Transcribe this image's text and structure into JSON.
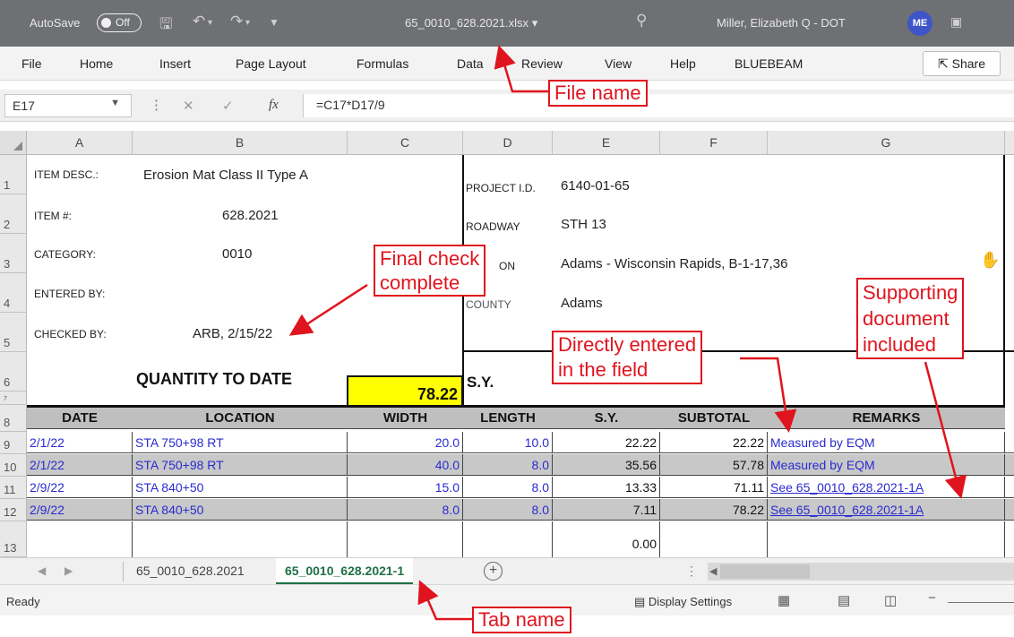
{
  "window": {
    "autosave_label": "AutoSave",
    "autosave_state": "Off",
    "filename": "65_0010_628.2021.xlsx",
    "filename_caret": "▾",
    "user_name": "Miller, Elizabeth Q - DOT",
    "user_initials": "ME"
  },
  "ribbon": {
    "tabs": [
      "File",
      "Home",
      "Insert",
      "Page Layout",
      "Formulas",
      "Data",
      "Review",
      "View",
      "Help",
      "BLUEBEAM"
    ],
    "share_label": "Share"
  },
  "formula_bar": {
    "cell_ref": "E17",
    "fx": "fx",
    "formula": "=C17*D17/9"
  },
  "columns": [
    "A",
    "B",
    "C",
    "D",
    "E",
    "F",
    "G"
  ],
  "rows": [
    "1",
    "2",
    "3",
    "4",
    "5",
    "6",
    "7",
    "8",
    "9",
    "10",
    "11",
    "12",
    "13"
  ],
  "header_block": {
    "item_desc_label": "ITEM DESC.:",
    "item_desc": "Erosion Mat Class II Type A",
    "item_no_label": "ITEM #:",
    "item_no": "628.2021",
    "category_label": "CATEGORY:",
    "category": "0010",
    "entered_by_label": "ENTERED BY:",
    "checked_by_label": "CHECKED BY:",
    "checked_by": "ARB, 2/15/22",
    "project_id_label": "PROJECT I.D.",
    "project_id": "6140-01-65",
    "roadway_label": "ROADWAY",
    "roadway": "STH 13",
    "location_label": "ON",
    "location": "Adams - Wisconsin Rapids, B-1-17,36",
    "county_label": "COUNTY",
    "county": "Adams",
    "qty_label": "QUANTITY TO DATE",
    "qty_value": "78.22",
    "qty_unit": "S.Y."
  },
  "table": {
    "headers": [
      "DATE",
      "LOCATION",
      "WIDTH",
      "LENGTH",
      "S.Y.",
      "SUBTOTAL",
      "REMARKS"
    ],
    "rows": [
      {
        "date": "2/1/22",
        "location": "STA 750+98 RT",
        "width": "20.0",
        "length": "10.0",
        "sy": "22.22",
        "subtotal": "22.22",
        "remarks": "Measured by EQM"
      },
      {
        "date": "2/1/22",
        "location": "STA 750+98 RT",
        "width": "40.0",
        "length": "8.0",
        "sy": "35.56",
        "subtotal": "57.78",
        "remarks": "Measured by EQM"
      },
      {
        "date": "2/9/22",
        "location": "STA 840+50",
        "width": "15.0",
        "length": "8.0",
        "sy": "13.33",
        "subtotal": "71.11",
        "remarks": "See 65_0010_628.2021-1A"
      },
      {
        "date": "2/9/22",
        "location": "STA 840+50",
        "width": "8.0",
        "length": "8.0",
        "sy": "7.11",
        "subtotal": "78.22",
        "remarks": "See 65_0010_628.2021-1A"
      }
    ],
    "partial_row_sy": "0.00"
  },
  "sheet_tabs": {
    "tabs": [
      "65_0010_628.2021",
      "65_0010_628.2021-1"
    ],
    "active_index": 1,
    "add_label": "+"
  },
  "status": {
    "ready": "Ready",
    "display_settings": "Display Settings"
  },
  "annotations": {
    "file_name": "File name",
    "final_check_1": "Final check",
    "final_check_2": "complete",
    "direct_1": "Directly entered",
    "direct_2": "in the field",
    "supporting_1": "Supporting",
    "supporting_2": "document",
    "supporting_3": "included",
    "tab_name": "Tab name"
  },
  "colors": {
    "accent_green": "#1e7145",
    "annotation_red": "#e0141e",
    "data_blue": "#2a2bd0",
    "highlight_yellow": "#ffff00"
  }
}
